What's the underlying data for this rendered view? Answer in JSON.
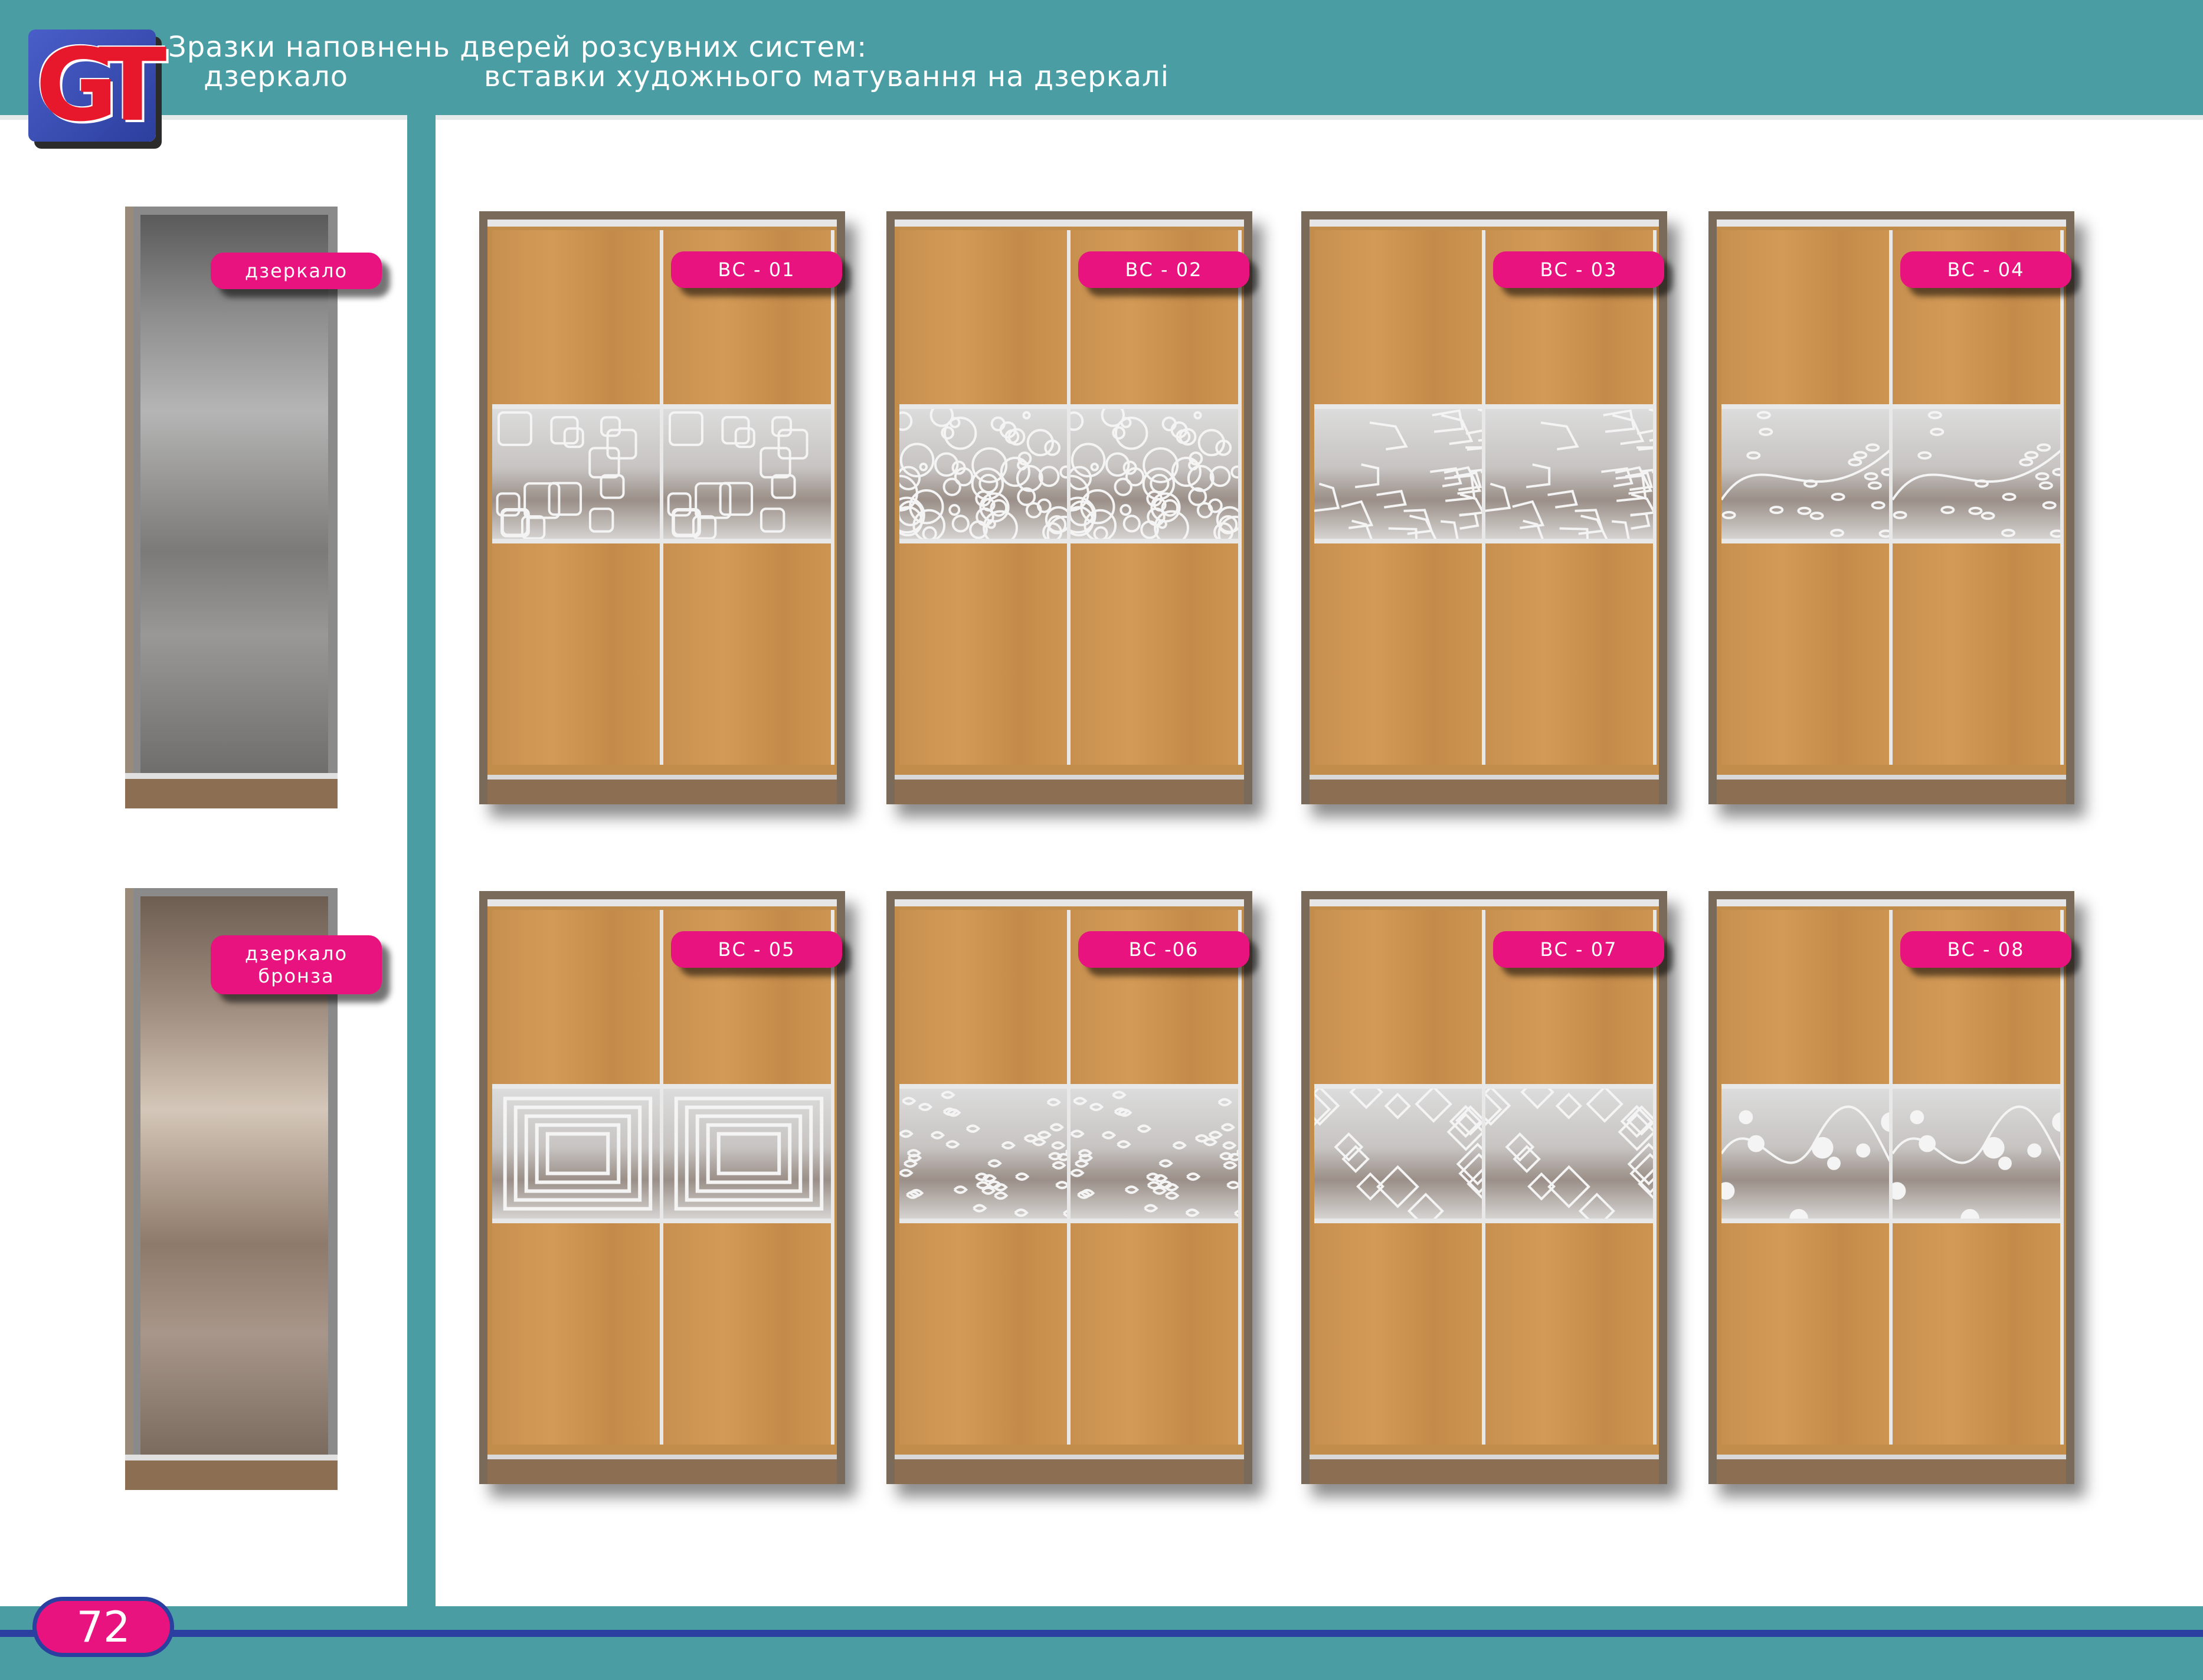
{
  "header": {
    "title_line1": "Зразки наповнень дверей розсувних систем:",
    "title_line2a": "дзеркало",
    "title_line2b": "вставки художнього матування на дзеркалі",
    "logo_text": "GT"
  },
  "mirrors": [
    {
      "label": "дзеркало"
    },
    {
      "label": "дзеркало бронза"
    }
  ],
  "wardrobes": [
    {
      "code": "ВС - 01",
      "pattern": "squares"
    },
    {
      "code": "ВС - 02",
      "pattern": "swirls"
    },
    {
      "code": "ВС - 03",
      "pattern": "cracks"
    },
    {
      "code": "ВС - 04",
      "pattern": "floral"
    },
    {
      "code": "ВС - 05",
      "pattern": "concentric-frames"
    },
    {
      "code": "ВС -06",
      "pattern": "leaves"
    },
    {
      "code": "ВС - 07",
      "pattern": "diamonds"
    },
    {
      "code": "ВС - 08",
      "pattern": "dots-vine"
    }
  ],
  "footer": {
    "page_number": "72"
  },
  "colors": {
    "teal": "#4a9ea3",
    "blue": "#2a3fa0",
    "pink": "#e8137f",
    "wood": "#c89050",
    "frame": "#7a6a5a"
  }
}
